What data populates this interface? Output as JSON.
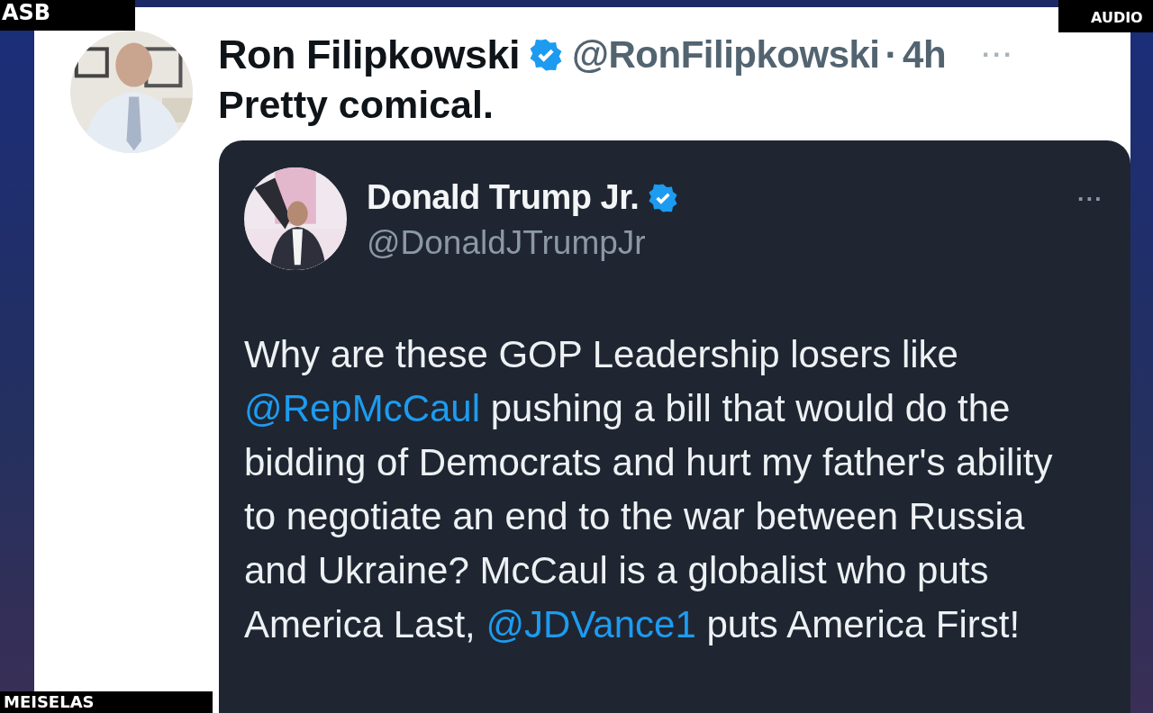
{
  "overlays": {
    "top_left": "ASB",
    "top_right": "AUDIO",
    "bottom_left": "MEISELAS"
  },
  "tweet": {
    "name": "Ron Filipkowski",
    "verified": true,
    "handle": "@RonFilipkowski",
    "separator": "·",
    "time": "4h",
    "more": "···",
    "text": "Pretty comical.",
    "quote": {
      "name": "Donald Trump Jr.",
      "verified": true,
      "handle": "@DonaldJTrumpJr",
      "more": "···",
      "body": [
        {
          "kind": "text",
          "text": "Why are these GOP Leadership losers like "
        },
        {
          "kind": "mention",
          "text": "@RepMcCaul"
        },
        {
          "kind": "text",
          "text": " pushing a bill that would do the bidding of Democrats and hurt my father's ability to negotiate an end to the war between Russia and Ukraine? McCaul is a globalist who puts America Last, "
        },
        {
          "kind": "mention",
          "text": "@JDVance1"
        },
        {
          "kind": "text",
          "text": " puts America First!"
        }
      ]
    }
  }
}
